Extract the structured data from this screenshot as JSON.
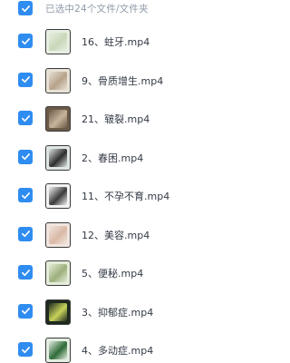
{
  "header": {
    "selected_text": "已选中24个文件/文件夹"
  },
  "files": [
    {
      "name": "16、蛀牙.mp4",
      "thumb": "#e7efe2",
      "thumb2": "#c9d8b8",
      "checked": true
    },
    {
      "name": "9、骨质增生.mp4",
      "thumb": "#e8e2d6",
      "thumb2": "#b7a28a",
      "checked": true
    },
    {
      "name": "21、皲裂.mp4",
      "thumb": "#6b5a48",
      "thumb2": "#c7b49c",
      "checked": true
    },
    {
      "name": "2、春困.mp4",
      "thumb": "#dfe6e3",
      "thumb2": "#2d2d2d",
      "checked": true
    },
    {
      "name": "11、不孕不育.mp4",
      "thumb": "#f2f2f2",
      "thumb2": "#3b3b3b",
      "checked": true
    },
    {
      "name": "12、美容.mp4",
      "thumb": "#f1e6df",
      "thumb2": "#d9b9a6",
      "checked": true
    },
    {
      "name": "5、便秘.mp4",
      "thumb": "#e5ecd9",
      "thumb2": "#9db07c",
      "checked": true
    },
    {
      "name": "3、抑郁症.mp4",
      "thumb": "#1e2a1e",
      "thumb2": "#c8d35a",
      "checked": true
    },
    {
      "name": "4、多动症.mp4",
      "thumb": "#e4ede1",
      "thumb2": "#2f6a38",
      "checked": true
    }
  ],
  "colors": {
    "checkbox": "#2f8cf0",
    "text": "#333a45",
    "header_text": "#8f9aa8"
  }
}
